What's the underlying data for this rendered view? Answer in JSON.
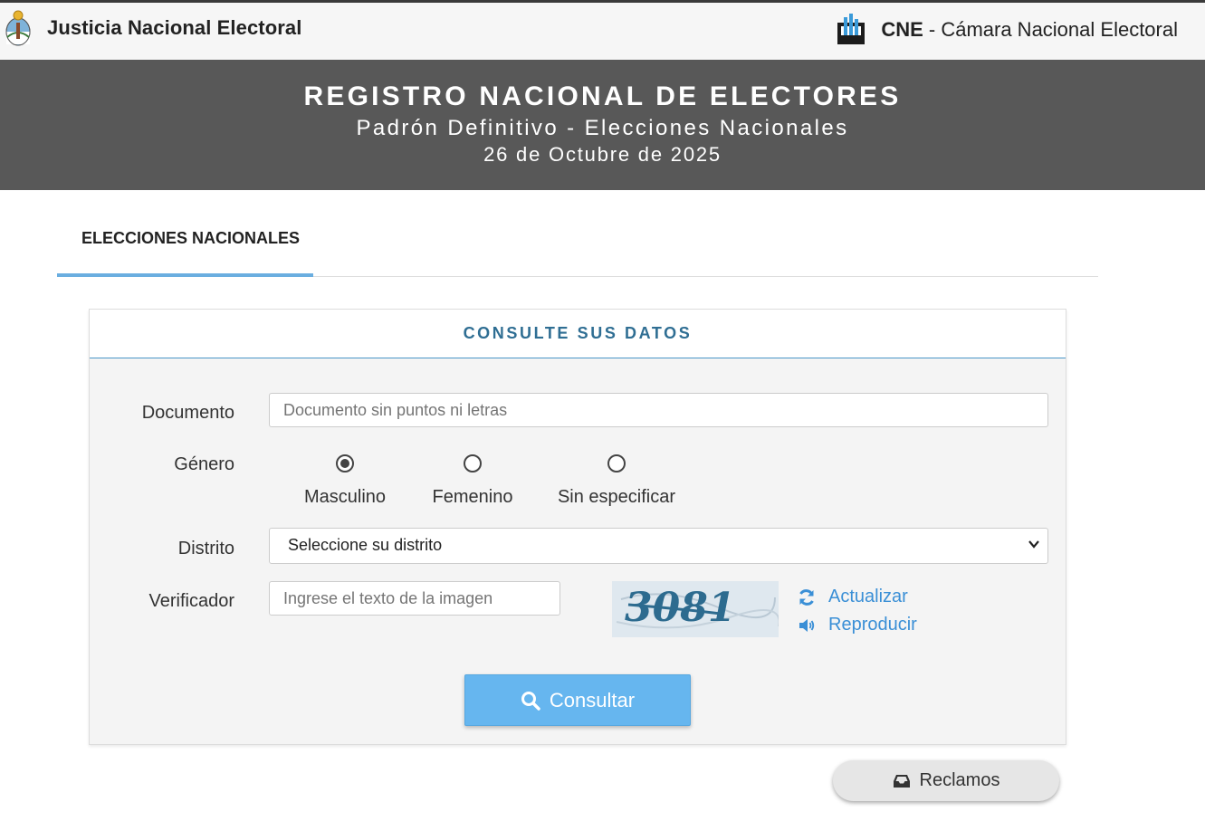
{
  "header": {
    "left_brand": "Justicia Nacional Electoral",
    "right_brand_bold": "CNE",
    "right_brand_rest": " - Cámara Nacional Electoral"
  },
  "banner": {
    "title": "REGISTRO NACIONAL DE ELECTORES",
    "subtitle": "Padrón Definitivo - Elecciones Nacionales",
    "date": "26 de Octubre de 2025"
  },
  "tabs": [
    {
      "label": "ELECCIONES NACIONALES",
      "active": true
    }
  ],
  "form": {
    "heading": "CONSULTE SUS DATOS",
    "documento": {
      "label": "Documento",
      "value": "",
      "placeholder": "Documento sin puntos ni letras"
    },
    "genero": {
      "label": "Género",
      "options": [
        {
          "label": "Masculino",
          "checked": true
        },
        {
          "label": "Femenino",
          "checked": false
        },
        {
          "label": "Sin especificar",
          "checked": false
        }
      ]
    },
    "distrito": {
      "label": "Distrito",
      "selected": "Seleccione su distrito"
    },
    "verificador": {
      "label": "Verificador",
      "value": "",
      "placeholder": "Ingrese el texto de la imagen"
    },
    "captcha_text": "3081",
    "actualizar_label": "Actualizar",
    "reproducir_label": "Reproducir",
    "submit_label": "Consultar"
  },
  "reclamos_label": "Reclamos",
  "colors": {
    "banner_bg": "#585858",
    "accent_blue": "#66b6ef",
    "link_blue": "#3a8fd6",
    "heading_blue": "#2f6e93"
  }
}
